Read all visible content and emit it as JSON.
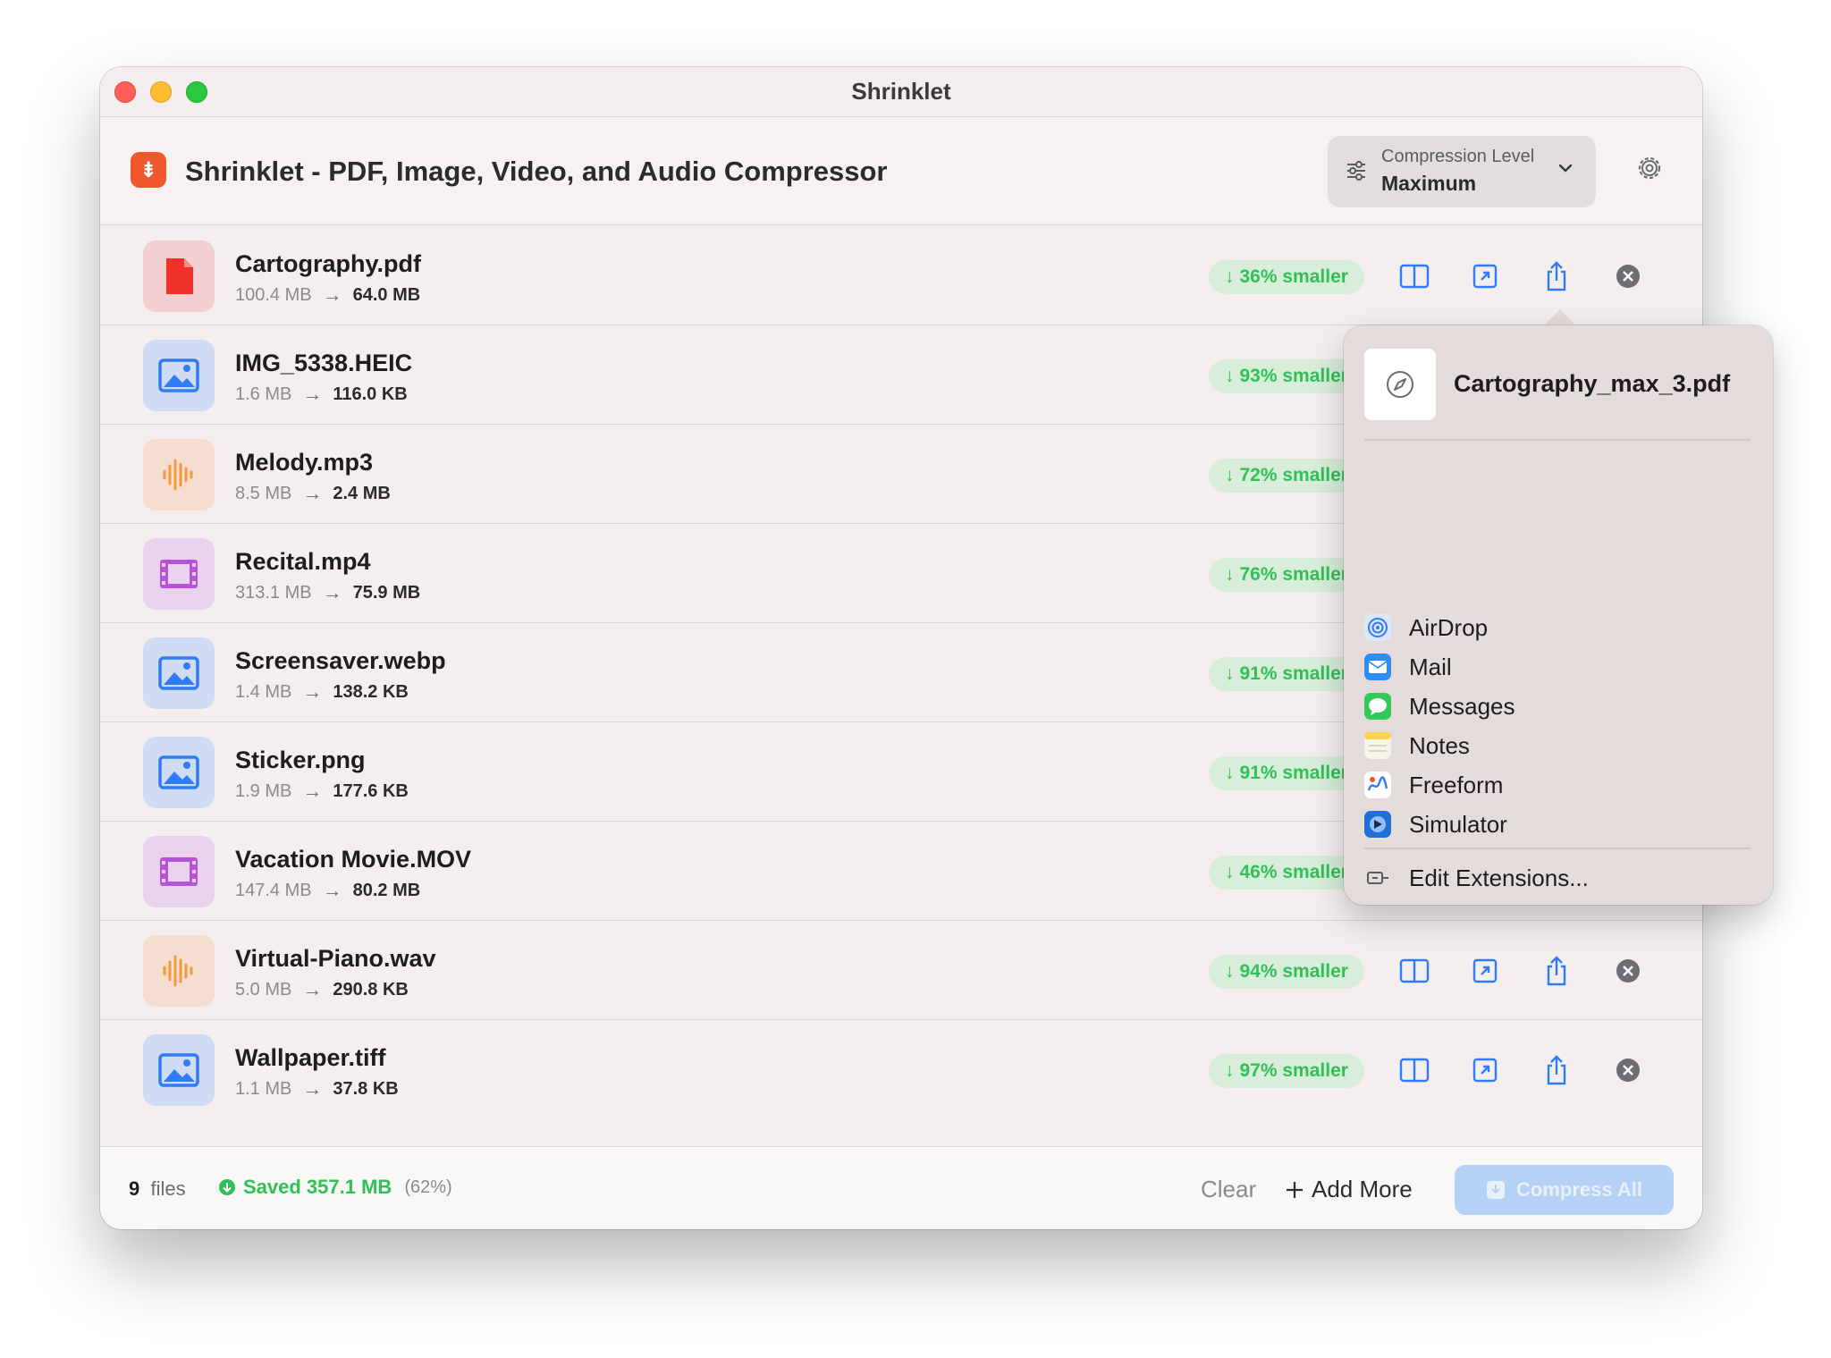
{
  "window": {
    "title": "Shrinklet"
  },
  "toolbar": {
    "app_heading": "Shrinklet - PDF, Image, Video, and Audio Compressor",
    "compression_label": "Compression Level",
    "compression_value": "Maximum"
  },
  "files": [
    {
      "name": "Cartography.pdf",
      "original": "100.4 MB",
      "compressed": "64.0 MB",
      "badge": "36% smaller",
      "kind": "pdf"
    },
    {
      "name": "IMG_5338.HEIC",
      "original": "1.6 MB",
      "compressed": "116.0 KB",
      "badge": "93% smaller",
      "kind": "image"
    },
    {
      "name": "Melody.mp3",
      "original": "8.5 MB",
      "compressed": "2.4 MB",
      "badge": "72% smaller",
      "kind": "audio"
    },
    {
      "name": "Recital.mp4",
      "original": "313.1 MB",
      "compressed": "75.9 MB",
      "badge": "76% smaller",
      "kind": "video"
    },
    {
      "name": "Screensaver.webp",
      "original": "1.4 MB",
      "compressed": "138.2 KB",
      "badge": "91% smaller",
      "kind": "image"
    },
    {
      "name": "Sticker.png",
      "original": "1.9 MB",
      "compressed": "177.6 KB",
      "badge": "91% smaller",
      "kind": "image"
    },
    {
      "name": "Vacation Movie.MOV",
      "original": "147.4 MB",
      "compressed": "80.2 MB",
      "badge": "46% smaller",
      "kind": "video"
    },
    {
      "name": "Virtual-Piano.wav",
      "original": "5.0 MB",
      "compressed": "290.8 KB",
      "badge": "94% smaller",
      "kind": "audio"
    },
    {
      "name": "Wallpaper.tiff",
      "original": "1.1 MB",
      "compressed": "37.8 KB",
      "badge": "97% smaller",
      "kind": "image"
    }
  ],
  "footer": {
    "file_count": "9",
    "file_count_label": "files",
    "saved_text": "Saved 357.1 MB",
    "saved_pct": "(62%)",
    "clear_label": "Clear",
    "add_more_label": "Add More",
    "compress_all_label": "Compress All"
  },
  "share_popover": {
    "filename": "Cartography_max_3.pdf",
    "items": [
      {
        "label": "AirDrop",
        "icon": "airdrop-icon"
      },
      {
        "label": "Mail",
        "icon": "mail-icon"
      },
      {
        "label": "Messages",
        "icon": "messages-icon"
      },
      {
        "label": "Notes",
        "icon": "notes-icon"
      },
      {
        "label": "Freeform",
        "icon": "freeform-icon"
      },
      {
        "label": "Simulator",
        "icon": "simulator-icon"
      }
    ],
    "edit_extensions": "Edit Extensions..."
  },
  "colors": {
    "accent_blue": "#2f7cf6",
    "success_green": "#30c056",
    "brand_orange": "#f0582d"
  }
}
